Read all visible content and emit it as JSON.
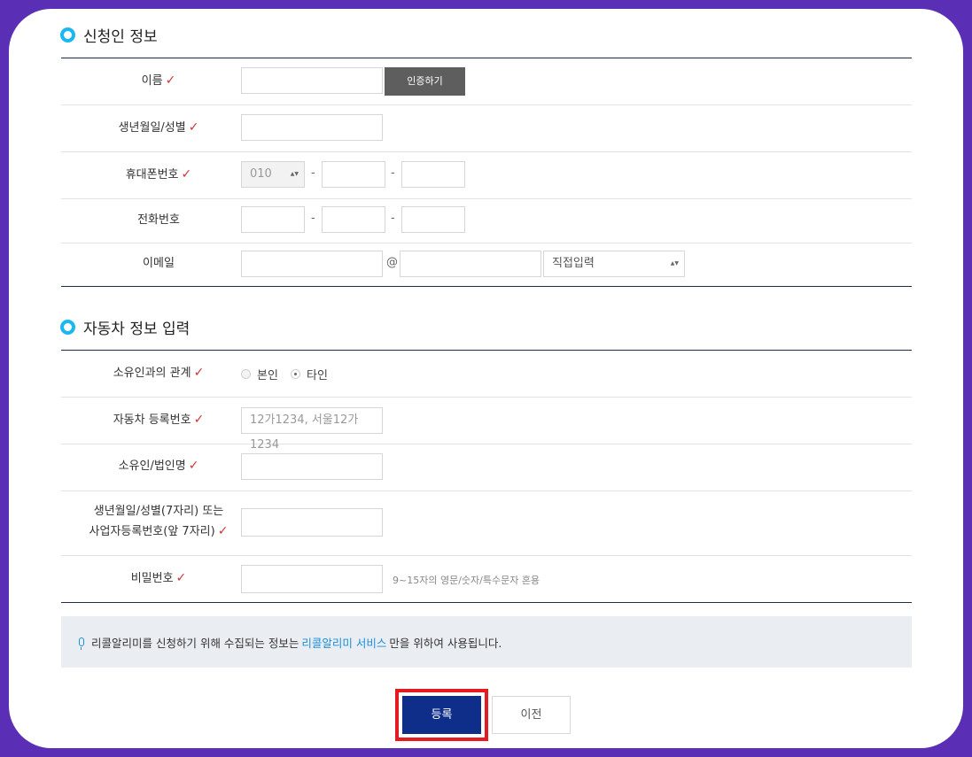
{
  "section1": {
    "title": "신청인 정보",
    "rows": {
      "name": {
        "label": "이름",
        "auth_button": "인증하기"
      },
      "birth": {
        "label": "생년월일/성별"
      },
      "mobile": {
        "label": "휴대폰번호",
        "prefix": "010",
        "sep": "-"
      },
      "phone": {
        "label": "전화번호",
        "sep": "-"
      },
      "email": {
        "label": "이메일",
        "at": "@",
        "domain_select": "직접입력"
      }
    }
  },
  "section2": {
    "title": "자동차 정보 입력",
    "rows": {
      "relation": {
        "label": "소유인과의 관계",
        "opt1": "본인",
        "opt2": "타인",
        "selected": "타인"
      },
      "plate": {
        "label": "자동차 등록번호",
        "placeholder": "12가1234, 서울12가1234"
      },
      "owner": {
        "label": "소유인/법인명"
      },
      "id": {
        "label1": "생년월일/성별(7자리) 또는",
        "label2": "사업자등록번호(앞 7자리)"
      },
      "password": {
        "label": "비밀번호",
        "hint": "9~15자의 영문/숫자/특수문자 혼용"
      }
    }
  },
  "notice": {
    "pre": "리콜알리미를 신청하기 위해 수집되는 정보는",
    "link": "리콜알리미 서비스",
    "post": "만을 위하여 사용됩니다."
  },
  "buttons": {
    "submit": "등록",
    "prev": "이전"
  },
  "check_mark": "✓",
  "select_arrow": "▲▼",
  "colors": {
    "accent": "#0e2e8a",
    "highlight": "#e41b23",
    "bullet": "#1ab8f0",
    "check": "#d0343a"
  }
}
